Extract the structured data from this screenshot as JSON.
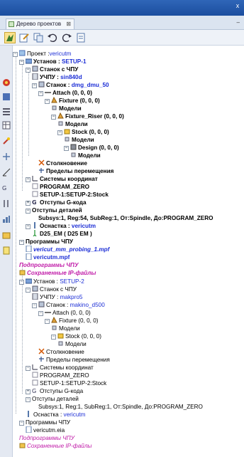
{
  "window": {
    "close": "x"
  },
  "tab": {
    "label": "Дерево проектов",
    "close": "⊠"
  },
  "tabbar": {
    "minimize": "–"
  },
  "toolbar": {
    "icons": [
      "select-icon",
      "edit-icon",
      "copy-icon",
      "undo-icon",
      "redo-icon",
      "properties-icon"
    ]
  },
  "leftbar": {
    "icons": [
      "colors-icon",
      "layers-icon",
      "list-icon",
      "table-icon",
      "tool-icon",
      "axis-icon",
      "measure-icon",
      "gcode-icon",
      "tool-sharpen-icon",
      "chart-icon",
      "folder-icon",
      "note-icon"
    ]
  },
  "tree": {
    "project_label": "Проект :",
    "project_name": "vericutm",
    "setup1": {
      "label": "Установ : ",
      "name": "SETUP-1",
      "cnc_machine": "Станок с ЧПУ",
      "control_label": "УЧПУ : ",
      "control_value": "sin840d",
      "machine_label": "Станок : ",
      "machine_value": "dmg_dmu_50",
      "attach": "Attach (0, 0, 0)",
      "fixture": "Fixture (0, 0, 0)",
      "models1": "Модели",
      "fixture_riser": "Fixture_Riser (0, 0, 0)",
      "models2": "Модели",
      "stock": "Stock (0, 0, 0)",
      "models3": "Модели",
      "design": "Design (0, 0, 0)",
      "models4": "Модели",
      "collision": "Столкновение",
      "travel_limits": "Пределы перемещения",
      "coord_systems": "Системы координат",
      "program_zero": "PROGRAM_ZERO",
      "setup_stock": "SETUP-1:SETUP-2:Stock",
      "gcode_offsets": "Отступы G-кода",
      "detail_offsets": "Отступы деталей",
      "subsys": "Subsys:1, Reg:54, SubReg:1, От:Spindle, До:PROGRAM_ZERO",
      "tooling_label": "Оснастка : ",
      "tooling_value": "vericutm",
      "tool": "D25_EM ( D25 EM )",
      "nc_programs": "Программы ЧПУ",
      "prog1": "vericut_mm_probing_1.mpf",
      "prog2": "vericutm.mpf",
      "subprograms": "Подпрограммы ЧПУ",
      "saved_ip": "Сохраненные IP-файлы"
    },
    "setup2": {
      "label": "Установ : ",
      "name": "SETUP-2",
      "cnc_machine": "Станок с ЧПУ",
      "control_label": "УЧПУ : ",
      "control_value": "makpro5",
      "machine_label": "Станок : ",
      "machine_value": "makino_d500",
      "attach": "Attach (0, 0, 0)",
      "fixture": "Fixture (0, 0, 0)",
      "models1": "Модели",
      "stock": "Stock (0, 0, 0)",
      "models2": "Модели",
      "collision": "Столкновение",
      "travel_limits": "Пределы перемещения",
      "coord_systems": "Системы координат",
      "program_zero": "PROGRAM_ZERO",
      "setup_stock": "SETUP-1:SETUP-2:Stock",
      "gcode_offsets": "Отступы G-кода",
      "detail_offsets": "Отступы деталей",
      "subsys": "Subsys:1, Reg:1, SubReg:1, От:Spindle, До:PROGRAM_ZERO",
      "tooling_label": "Оснастка : ",
      "tooling_value": "vericutm",
      "nc_programs": "Программы ЧПУ",
      "prog1": "vericutm.eia",
      "subprograms": "Подпрограммы ЧПУ",
      "saved_ip": "Сохраненные IP-файлы"
    }
  }
}
